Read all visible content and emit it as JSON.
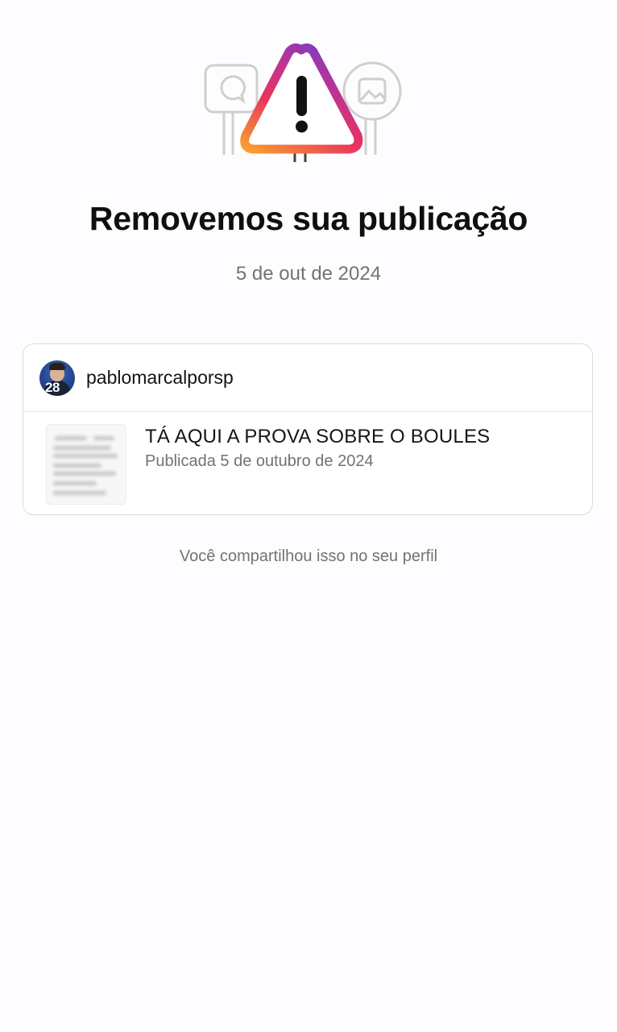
{
  "notice": {
    "title": "Removemos sua publicação",
    "date": "5 de out de 2024",
    "illustration_icon": "warning-sign-icon",
    "accent_gradient": [
      "#f58529",
      "#dd2a7b",
      "#8134af"
    ]
  },
  "post_card": {
    "username": "pablomarcalporsp",
    "avatar_badge": "28",
    "caption": "TÁ AQUI A PROVA SOBRE O BOULES",
    "published_label": "Publicada 5 de outubro de 2024"
  },
  "footnote": "Você compartilhou isso no seu perfil"
}
